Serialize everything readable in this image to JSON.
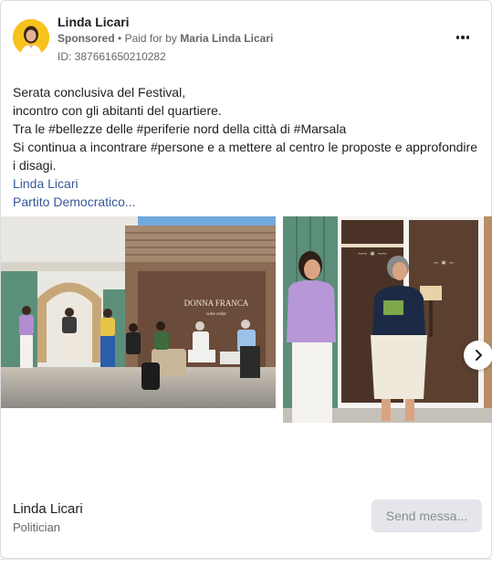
{
  "header": {
    "page_name": "Linda Licari",
    "sponsored": "Sponsored",
    "separator": "•",
    "paid_for_prefix": "Paid for by",
    "paid_for_name": "Maria Linda Licari",
    "ad_id": "ID: 387661650210282",
    "more_icon": "more-horizontal-icon"
  },
  "post": {
    "lines": [
      "Serata conclusiva del Festival,",
      "incontro con gli abitanti del quartiere.",
      "Tra le #bellezze delle #periferie nord della città di #Marsala",
      "Si continua a incontrare #persone e a mettere al centro le proposte e approfondire",
      "i disagi."
    ],
    "links": [
      "Linda Licari",
      "Partito Democratico..."
    ]
  },
  "carousel": {
    "photo1_sign_line1": "DONNA FRANCA",
    "photo1_sign_line2": "wine cellar",
    "next_icon": "chevron-right-icon"
  },
  "footer": {
    "name": "Linda Licari",
    "role": "Politician",
    "button_label": "Send messa..."
  },
  "colors": {
    "link": "#385898",
    "secondary_text": "#65676b",
    "avatar_bg": "#f7c21b",
    "button_bg": "#e4e6eb"
  }
}
